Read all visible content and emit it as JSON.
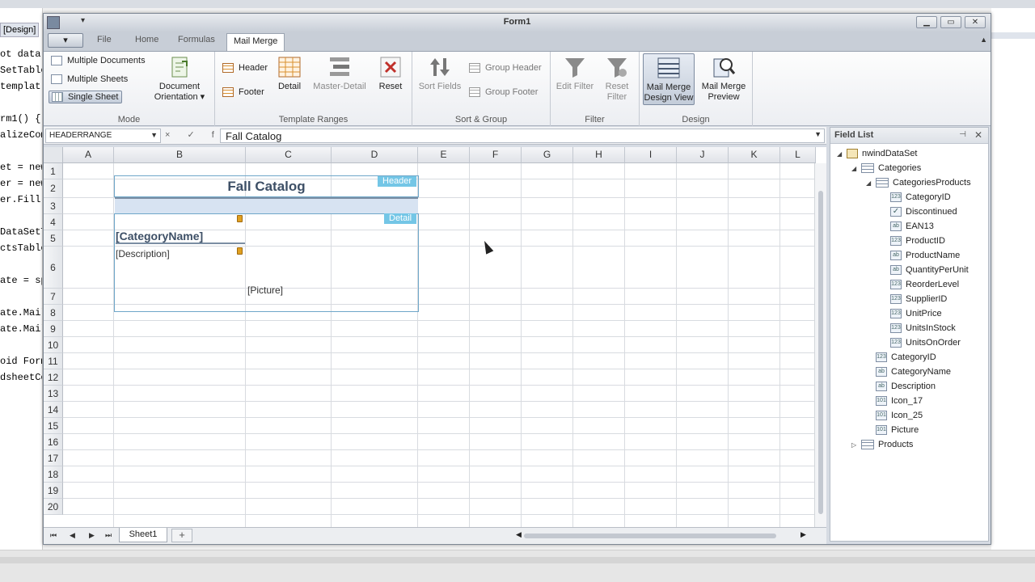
{
  "ide": {
    "designer_tab": "[Design]",
    "code_lines": [
      "ot data",
      "SetTable",
      "templat",
      "",
      "rm1() {",
      "alizeCom",
      "",
      "et = new",
      "er = new",
      "er.Fill(",
      "",
      "DataSetT",
      "ctsTable",
      "",
      "ate = sp",
      "",
      "ate.Mail",
      "ate.Mail",
      "",
      "oid Form",
      "dsheetCo"
    ]
  },
  "window": {
    "title": "Form1",
    "qat": "▾"
  },
  "ribbon": {
    "file_label": "▾",
    "tabs": [
      {
        "label": "File"
      },
      {
        "label": "Home"
      },
      {
        "label": "Formulas"
      },
      {
        "label": "Mail Merge"
      }
    ],
    "groups": {
      "mode": {
        "label": "Mode",
        "multiple_documents": "Multiple Documents",
        "multiple_sheets": "Multiple Sheets",
        "single_sheet": "Single Sheet",
        "document_orientation": "Document Orientation ▾"
      },
      "template_ranges": {
        "label": "Template Ranges",
        "header": "Header",
        "footer": "Footer",
        "detail": "Detail",
        "master_detail": "Master-Detail",
        "reset": "Reset"
      },
      "sort_group": {
        "label": "Sort & Group",
        "sort_fields": "Sort Fields",
        "group_header": "Group Header",
        "group_footer": "Group Footer"
      },
      "filter": {
        "label": "Filter",
        "edit_filter": "Edit Filter",
        "reset_filter": "Reset Filter"
      },
      "design": {
        "label": "Design",
        "design_view": "Mail Merge Design View",
        "preview": "Mail Merge Preview"
      }
    }
  },
  "formula_bar": {
    "name_box": "HEADERRANGE",
    "fx_buttons": "× ✓ fx",
    "formula": "Fall Catalog"
  },
  "sheet": {
    "columns": [
      "A",
      "B",
      "C",
      "D",
      "E",
      "F",
      "G",
      "H",
      "I",
      "J",
      "K",
      "L"
    ],
    "rows": [
      "1",
      "2",
      "3",
      "4",
      "5",
      "6",
      "7",
      "8",
      "9",
      "10",
      "11",
      "12",
      "13",
      "14",
      "15",
      "16",
      "17",
      "18",
      "19",
      "20"
    ],
    "title_cell": "Fall Catalog",
    "header_tag": "Header",
    "detail_tag": "Detail",
    "category_name": "[CategoryName]",
    "description": "[Description]",
    "picture": "[Picture]",
    "tab_name": "Sheet1",
    "add_tab": "+"
  },
  "field_list": {
    "title": "Field List",
    "pin": "⊣",
    "close": "✕",
    "nodes": [
      {
        "label": "nwindDataSet",
        "icon": "dataset-icon"
      },
      {
        "label": "Categories",
        "icon": "table-icon"
      },
      {
        "label": "CategoriesProducts",
        "icon": "table-icon"
      },
      {
        "label": "CategoryID",
        "icon": "number-field-icon"
      },
      {
        "label": "Discontinued",
        "icon": "checkbox-field-icon"
      },
      {
        "label": "EAN13",
        "icon": "text-field-icon"
      },
      {
        "label": "ProductID",
        "icon": "number-field-icon"
      },
      {
        "label": "ProductName",
        "icon": "text-field-icon"
      },
      {
        "label": "QuantityPerUnit",
        "icon": "text-field-icon"
      },
      {
        "label": "ReorderLevel",
        "icon": "number-field-icon"
      },
      {
        "label": "SupplierID",
        "icon": "number-field-icon"
      },
      {
        "label": "UnitPrice",
        "icon": "number-field-icon"
      },
      {
        "label": "UnitsInStock",
        "icon": "number-field-icon"
      },
      {
        "label": "UnitsOnOrder",
        "icon": "number-field-icon"
      },
      {
        "label": "CategoryID",
        "icon": "number-field-icon"
      },
      {
        "label": "CategoryName",
        "icon": "text-field-icon"
      },
      {
        "label": "Description",
        "icon": "text-field-icon"
      },
      {
        "label": "Icon_17",
        "icon": "binary-field-icon"
      },
      {
        "label": "Icon_25",
        "icon": "binary-field-icon"
      },
      {
        "label": "Picture",
        "icon": "binary-field-icon"
      },
      {
        "label": "Products",
        "icon": "table-icon"
      }
    ]
  },
  "icon_glyphs": {
    "number": "123",
    "text": "ab",
    "binary": "101",
    "check": "✓"
  }
}
